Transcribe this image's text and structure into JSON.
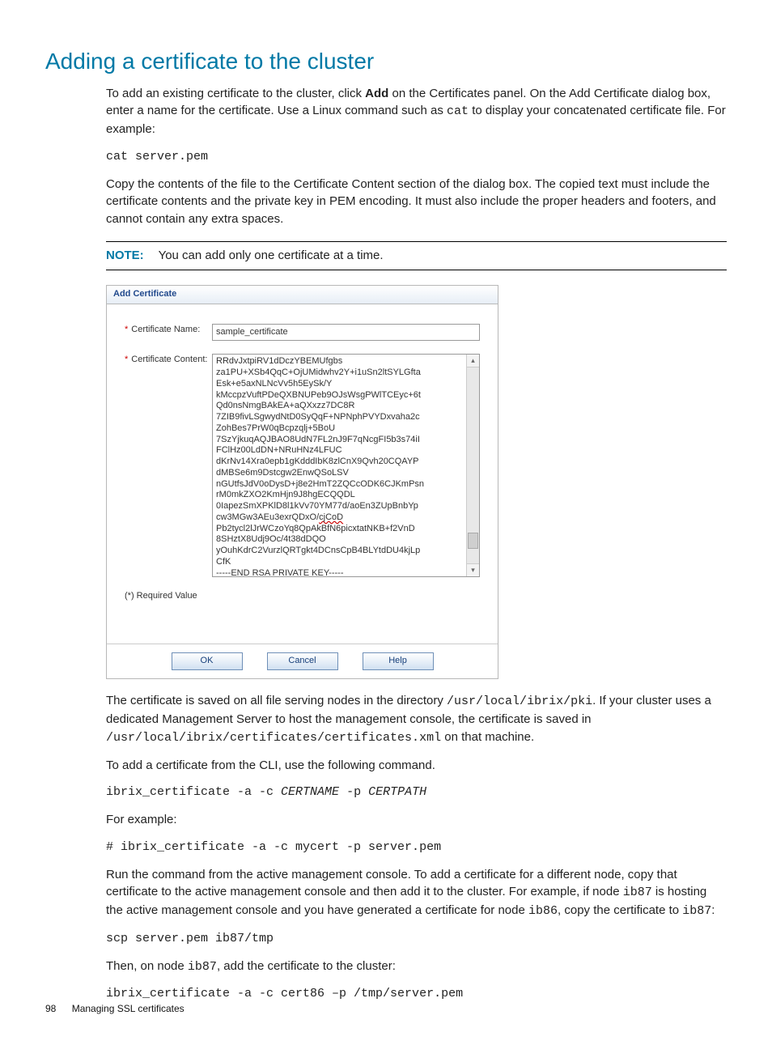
{
  "title": "Adding a certificate to the cluster",
  "intro": {
    "pre": "To add an existing certificate to the cluster, click ",
    "add": "Add",
    "mid": " on the Certificates panel. On the Add Certificate dialog box, enter a name for the certificate. Use a Linux command such as ",
    "cat": "cat",
    "post": " to display your concatenated certificate file. For example:"
  },
  "cmd1": "cat server.pem",
  "para2": "Copy the contents of the file to the Certificate Content section of the dialog box. The copied text must include the certificate contents and the private key in PEM encoding. It must also include the proper headers and footers, and cannot contain any extra spaces.",
  "note": {
    "label": "NOTE:",
    "text": "You can add only one certificate at a time."
  },
  "dialog": {
    "title": "Add Certificate",
    "name_label": "Certificate Name:",
    "content_label": "Certificate Content:",
    "name_value": "sample_certificate",
    "content_value_pre": "RRdvJxtpiRV1dDczYBEMUfgbs\nza1PU+XSb4QqC+OjUMidwhv2Y+i1uSn2ltSYLGfta\nEsk+e5axNLNcVv5h5EySk/Y\nkMccpzVuftPDeQXBNUPeb9OJsWsgPWlTCEyc+6t\nQd0nsNmgBAkEA+aQXxzz7DC8R\n7ZIB9fivLSgwydNtD0SyQqF+NPNphPVYDxvaha2c\nZohBes7PrW0qBcpzqlj+5BoU\n7SzYjkuqAQJBAO8UdN7FL2nJ9F7qNcgFI5b3s74iI\nFClHz00LdDN+NRuHNz4LFUC\ndKrNv14Xra0epb1gKdddIbK8zlCnX9Qvh20CQAYP\ndMBSe6m9Dstcgw2EnwQSoLSV\nnGUtfsJdV0oDysD+j8e2HmT2ZQCcODK6CJKmPsn\nrM0mkZXO2KmHjn9J8hgECQQDL\n0IapezSmXPKlD8l1kVv70YM77d/aoEn3ZUpBnbYp\ncw3MGw3AEu3exrQDxO/",
    "content_value_mid": "cjCoD",
    "content_value_post": "\nPb2tycl2lJrWCzoYq8QpAkBfN6picxtatNKB+f2VnD\n8SHztX8Udj9Oc/4t38dDQO\nyOuhKdrC2VurzlQRTgkt4DCnsCpB4BLYtdDU4kjLp\nCfK\n-----END ",
    "content_value_rsa": "RSA",
    "content_value_tail": " PRIVATE KEY-----",
    "req_note": "(*) Required Value",
    "ok": "OK",
    "cancel": "Cancel",
    "help": "Help"
  },
  "after": {
    "para3_pre": "The certificate is saved on all file serving nodes in the directory ",
    "path1": "/usr/local/ibrix/pki",
    "para3_mid": ". If your cluster uses a dedicated Management Server to host the management console, the certificate is saved in ",
    "path2": "/usr/local/ibrix/certificates/certificates.xml",
    "para3_post": " on that machine.",
    "para4": "To add a certificate from the CLI, use the following command."
  },
  "cmd2": {
    "a": "ibrix_certificate -a -c ",
    "b": "CERTNAME",
    "c": " -p ",
    "d": "CERTPATH"
  },
  "eg_label": "For example:",
  "cmd3": "# ibrix_certificate -a -c mycert -p server.pem",
  "para5": {
    "a": "Run the command from the active management console. To add a certificate for a different node, copy that certificate to the active management console and then add it to the cluster. For example, if node ",
    "b": "ib87",
    "c": " is hosting the active management console and you have generated a certificate for node ",
    "d": "ib86",
    "e": ", copy the certificate to ",
    "f": "ib87",
    "g": ":"
  },
  "cmd4": "scp server.pem ib87/tmp",
  "para6": {
    "a": "Then, on node ",
    "b": "ib87",
    "c": ", add the certificate to the cluster:"
  },
  "cmd5": "ibrix_certificate -a -c cert86 –p /tmp/server.pem",
  "footer": {
    "page_num": "98",
    "section": "Managing SSL certificates"
  }
}
